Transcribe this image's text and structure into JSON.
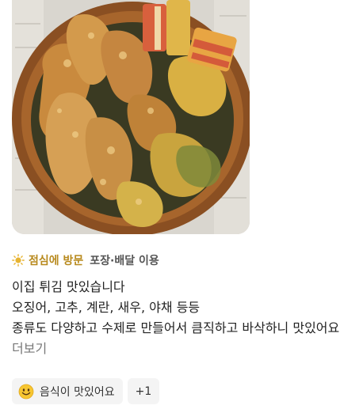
{
  "photo": {
    "subject": "fried seafood and vegetable tempura in a wooden basket"
  },
  "visit": {
    "icon": "sun-icon",
    "when": "점심에 방문",
    "how": "포장·배달 이용",
    "accent_color": "#b88a1e"
  },
  "review": {
    "lines": [
      "이집 튀김 맛있습니다",
      "오징어, 고추, 계란, 새우, 야채 등등",
      "종류도 다양하고 수제로 만들어서 큼직하고 바삭하니 맛있어요"
    ],
    "more_label": "더보기"
  },
  "tags": {
    "items": [
      {
        "icon": "smiling-face-icon",
        "label": "음식이 맛있어요"
      }
    ],
    "more_label": "+1"
  }
}
